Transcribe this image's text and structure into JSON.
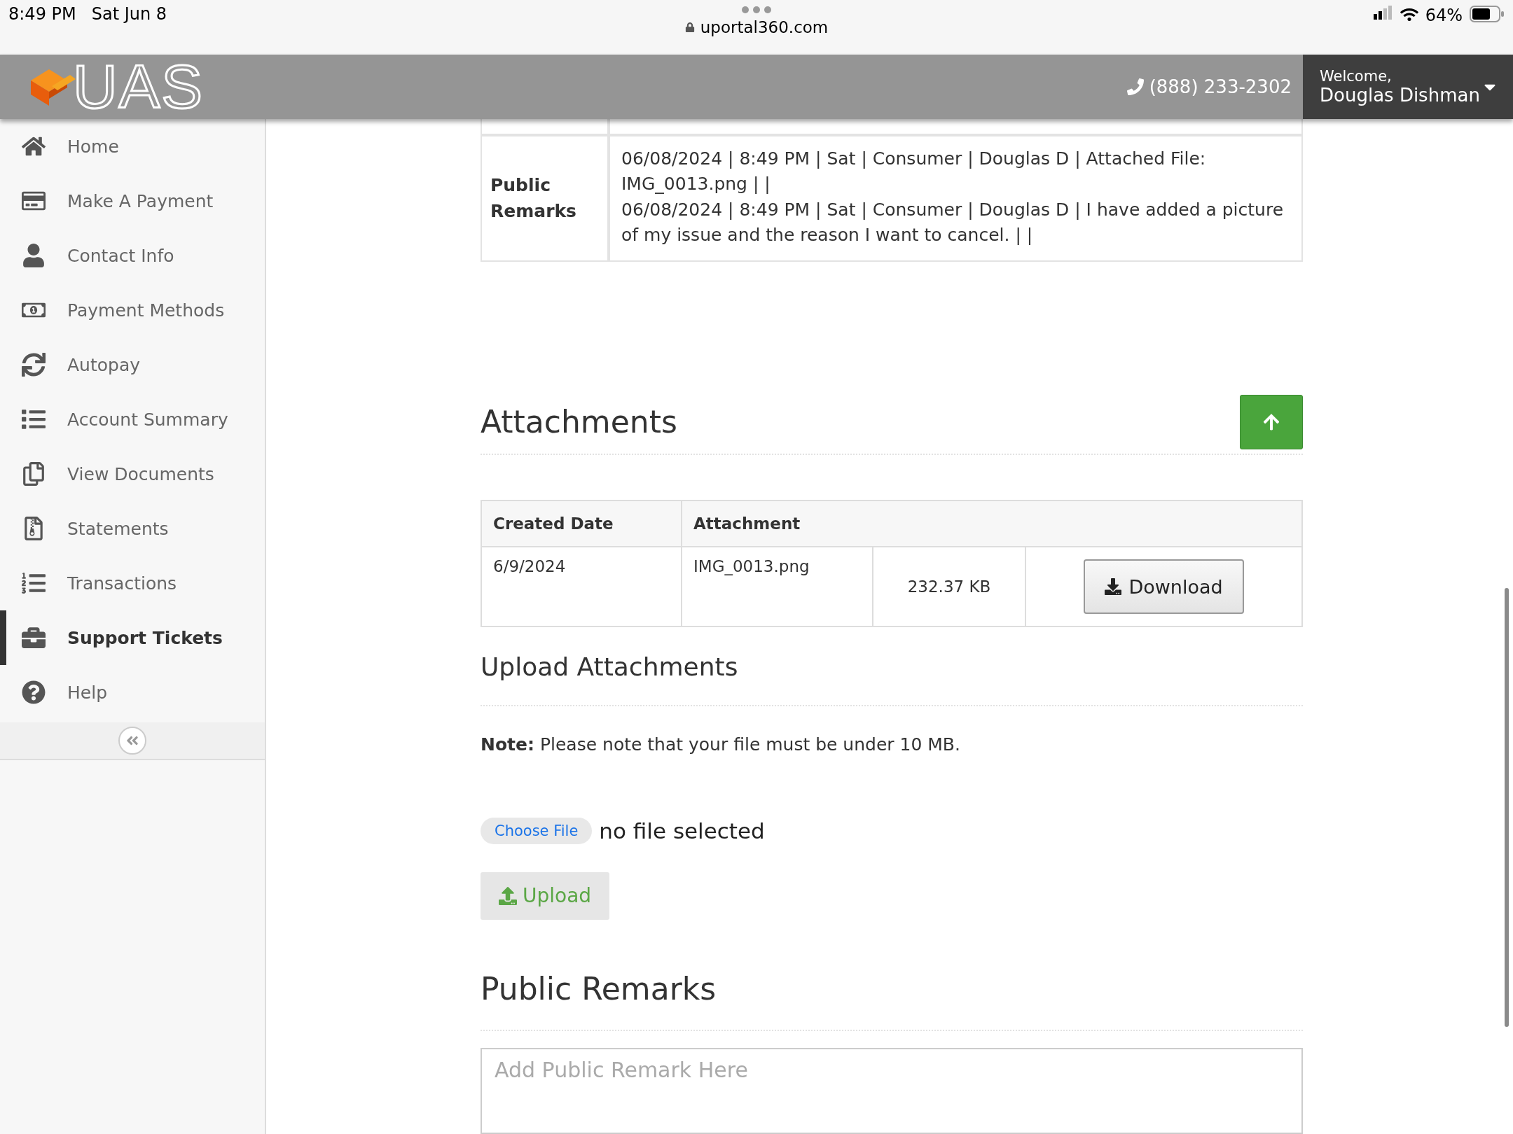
{
  "status_bar": {
    "time": "8:49 PM",
    "date": "Sat Jun 8",
    "url": "uportal360.com",
    "battery": "64%"
  },
  "header": {
    "logo": "UAS",
    "phone": "(888) 233-2302",
    "welcome": "Welcome,",
    "user": "Douglas Dishman"
  },
  "sidebar": {
    "items": [
      {
        "label": "Home",
        "selected": false
      },
      {
        "label": "Make A Payment",
        "selected": false
      },
      {
        "label": "Contact Info",
        "selected": false
      },
      {
        "label": "Payment Methods",
        "selected": false
      },
      {
        "label": "Autopay",
        "selected": false
      },
      {
        "label": "Account Summary",
        "selected": false
      },
      {
        "label": "View Documents",
        "selected": false
      },
      {
        "label": "Statements",
        "selected": false
      },
      {
        "label": "Transactions",
        "selected": false
      },
      {
        "label": "Support Tickets",
        "selected": true
      },
      {
        "label": "Help",
        "selected": false
      }
    ]
  },
  "details_table": {
    "rows": [
      {
        "label": "Public Remarks",
        "entries": [
          "06/08/2024 | 8:49 PM | Sat | Consumer | Douglas D | Attached File: IMG_0013.png | |",
          "06/08/2024 | 8:49 PM | Sat | Consumer | Douglas D | I have added a picture of my issue and the reason I want to cancel. | |"
        ]
      }
    ]
  },
  "attachments": {
    "title": "Attachments",
    "columns": [
      "Created Date",
      "Attachment"
    ],
    "rows": [
      {
        "created_date": "6/9/2024",
        "file_name": "IMG_0013.png",
        "size": "232.37 KB",
        "action": "Download"
      }
    ]
  },
  "upload": {
    "title": "Upload Attachments",
    "note": "**Note:** Please note that your file must be under 10 MB.",
    "choose_file": "Choose File",
    "file_status": "no file selected",
    "button": "Upload"
  },
  "public_remarks": {
    "title": "Public Remarks",
    "placeholder": "Add Public Remark Here"
  }
}
